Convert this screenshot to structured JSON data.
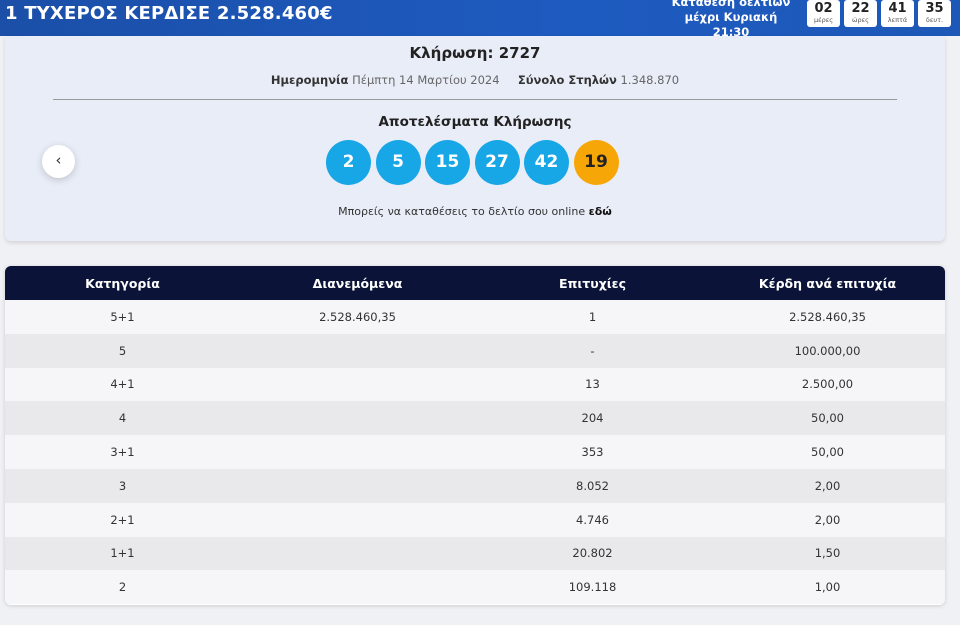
{
  "banner": {
    "title": "1 ΤΥΧΕΡΟΣ ΚΕΡΔΙΣΕ 2.528.460€",
    "deadline_line1": "Κατάθεση δελτίων",
    "deadline_line2": "μέχρι Κυριακή 21:30",
    "countdown": [
      {
        "value": "02",
        "unit": "μέρες"
      },
      {
        "value": "22",
        "unit": "ώρες"
      },
      {
        "value": "41",
        "unit": "λεπτά"
      },
      {
        "value": "35",
        "unit": "δευτ."
      }
    ]
  },
  "draw": {
    "title": "Κλήρωση: 2727",
    "date_label": "Ημερομηνία",
    "date_value": "Πέμπτη 14 Μαρτίου 2024",
    "columns_label": "Σύνολο Στηλών",
    "columns_value": "1.348.870",
    "results_title": "Αποτελέσματα Κλήρωσης",
    "numbers": [
      "2",
      "5",
      "15",
      "27",
      "42"
    ],
    "joker": "19",
    "prev_icon": "‹",
    "online_text": "Μπορείς να καταθέσεις το δελτίο σου online",
    "online_link": "εδώ"
  },
  "colors": {
    "ball": "#17a6e6",
    "joker": "#f7a608",
    "header_bg": "#0b1438",
    "banner_bg": "#1e5bc0"
  },
  "table": {
    "headers": [
      "Κατηγορία",
      "Διανεμόμενα",
      "Επιτυχίες",
      "Κέρδη ανά επιτυχία"
    ],
    "rows": [
      [
        "5+1",
        "2.528.460,35",
        "1",
        "2.528.460,35"
      ],
      [
        "5",
        "",
        "-",
        "100.000,00"
      ],
      [
        "4+1",
        "",
        "13",
        "2.500,00"
      ],
      [
        "4",
        "",
        "204",
        "50,00"
      ],
      [
        "3+1",
        "",
        "353",
        "50,00"
      ],
      [
        "3",
        "",
        "8.052",
        "2,00"
      ],
      [
        "2+1",
        "",
        "4.746",
        "2,00"
      ],
      [
        "1+1",
        "",
        "20.802",
        "1,50"
      ],
      [
        "2",
        "",
        "109.118",
        "1,00"
      ]
    ]
  }
}
